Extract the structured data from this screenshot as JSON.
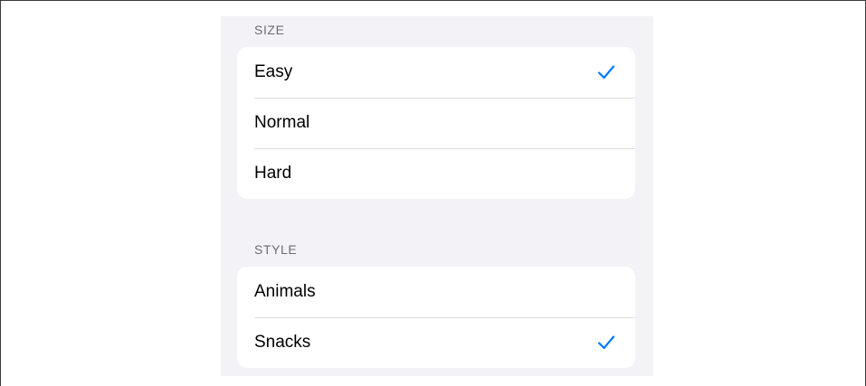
{
  "accent_color": "#007aff",
  "sections": [
    {
      "header": "SIZE",
      "options": [
        {
          "label": "Easy",
          "selected": true
        },
        {
          "label": "Normal",
          "selected": false
        },
        {
          "label": "Hard",
          "selected": false
        }
      ]
    },
    {
      "header": "STYLE",
      "options": [
        {
          "label": "Animals",
          "selected": false
        },
        {
          "label": "Snacks",
          "selected": true
        }
      ]
    }
  ],
  "icons": {
    "selected_indicator": "checkmark-icon"
  }
}
